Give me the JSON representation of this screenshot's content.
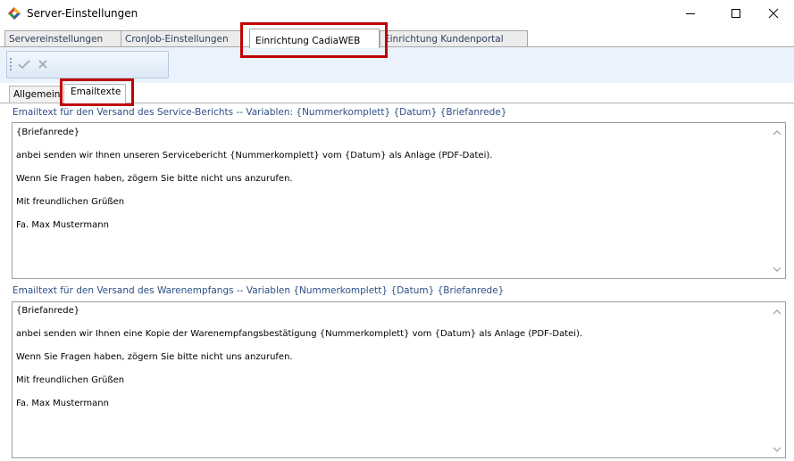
{
  "window": {
    "title": "Server-Einstellungen"
  },
  "main_tabs": [
    {
      "label": "Servereinstellungen"
    },
    {
      "label": "CronJob-Einstellungen"
    },
    {
      "label": "Einrichtung CadiaWEB"
    },
    {
      "label": "Einrichtung Kundenportal"
    }
  ],
  "sub_tabs": [
    {
      "label": "Allgemein"
    },
    {
      "label": "Emailtexte"
    }
  ],
  "service_report": {
    "label": "Emailtext für den Versand des Service-Berichts -- Variablen: {Nummerkomplett} {Datum} {Briefanrede}",
    "lines": [
      "{Briefanrede}",
      "anbei senden wir Ihnen unseren Servicebericht {Nummerkomplett} vom {Datum} als Anlage (PDF-Datei).",
      "Wenn Sie Fragen haben, zögern Sie bitte nicht uns anzurufen.",
      "Mit freundlichen Grüßen",
      "Fa. Max Mustermann"
    ]
  },
  "goods_receipt": {
    "label": "Emailtext für den Versand des Warenempfangs  -- Variablen {Nummerkomplett} {Datum} {Briefanrede}",
    "lines": [
      "{Briefanrede}",
      "anbei senden wir Ihnen eine Kopie der Warenempfangsbestätigung {Nummerkomplett} vom {Datum} als Anlage (PDF-Datei).",
      "Wenn Sie Fragen haben, zögern Sie bitte nicht uns anzurufen.",
      "Mit freundlichen Grüßen",
      "Fa. Max Mustermann"
    ]
  },
  "icons": {
    "app": "app-logo-icon",
    "save": "checkmark-icon",
    "cancel": "x-icon"
  },
  "colors": {
    "highlight": "#c00000",
    "label_blue": "#2d4f86"
  }
}
